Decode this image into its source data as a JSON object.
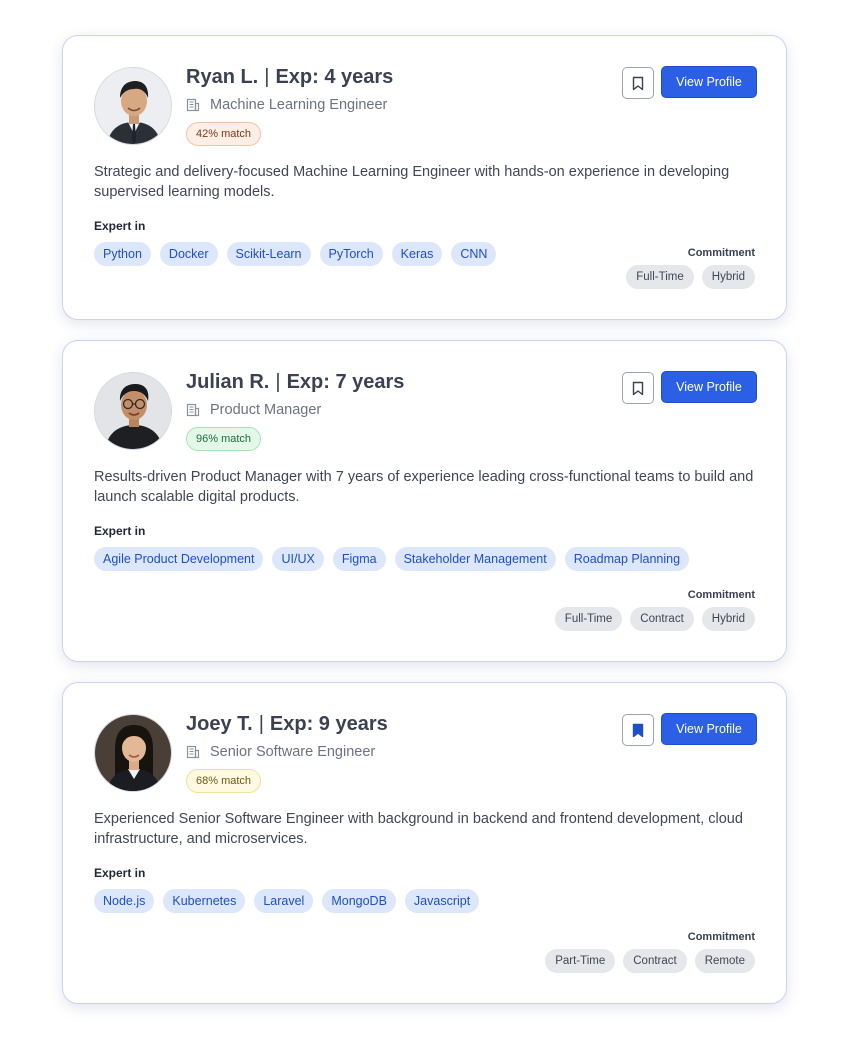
{
  "candidates": [
    {
      "name": "Ryan L.",
      "experience": "Exp: 4 years",
      "role": "Machine Learning Engineer",
      "match": "42% match",
      "bookmarked": false,
      "view_label": "View Profile",
      "summary": "Strategic and delivery-focused Machine Learning Engineer with hands-on experience in developing supervised learning models.",
      "expert_label": "Expert in",
      "skills": [
        "Python",
        "Docker",
        "Scikit-Learn",
        "PyTorch",
        "Keras",
        "CNN"
      ],
      "commitment_label": "Commitment",
      "commitments": [
        "Full-Time",
        "Hybrid"
      ]
    },
    {
      "name": "Julian R.",
      "experience": "Exp: 7 years",
      "role": "Product Manager",
      "match": "96% match",
      "bookmarked": false,
      "view_label": "View Profile",
      "summary": "Results-driven Product Manager with 7 years of experience leading cross-functional teams to build and launch scalable digital products.",
      "expert_label": "Expert in",
      "skills": [
        "Agile Product Development",
        "UI/UX",
        "Figma",
        "Stakeholder Management",
        "Roadmap Planning"
      ],
      "commitment_label": "Commitment",
      "commitments": [
        "Full-Time",
        "Contract",
        "Hybrid"
      ]
    },
    {
      "name": "Joey T.",
      "experience": "Exp: 9 years",
      "role": "Senior Software Engineer",
      "match": "68% match",
      "bookmarked": true,
      "view_label": "View Profile",
      "summary": "Experienced Senior Software Engineer with background in backend and frontend development, cloud infrastructure, and microservices.",
      "expert_label": "Expert in",
      "skills": [
        "Node.js",
        "Kubernetes",
        "Laravel",
        "MongoDB",
        "Javascript"
      ],
      "commitment_label": "Commitment",
      "commitments": [
        "Part-Time",
        "Contract",
        "Remote"
      ]
    }
  ],
  "icons": {
    "role": "building-icon",
    "bookmark": "bookmark-icon"
  },
  "colors": {
    "accent": "#2a5fe6",
    "skill_bg": "#dde7fb",
    "skill_text": "#1f4fc8"
  }
}
